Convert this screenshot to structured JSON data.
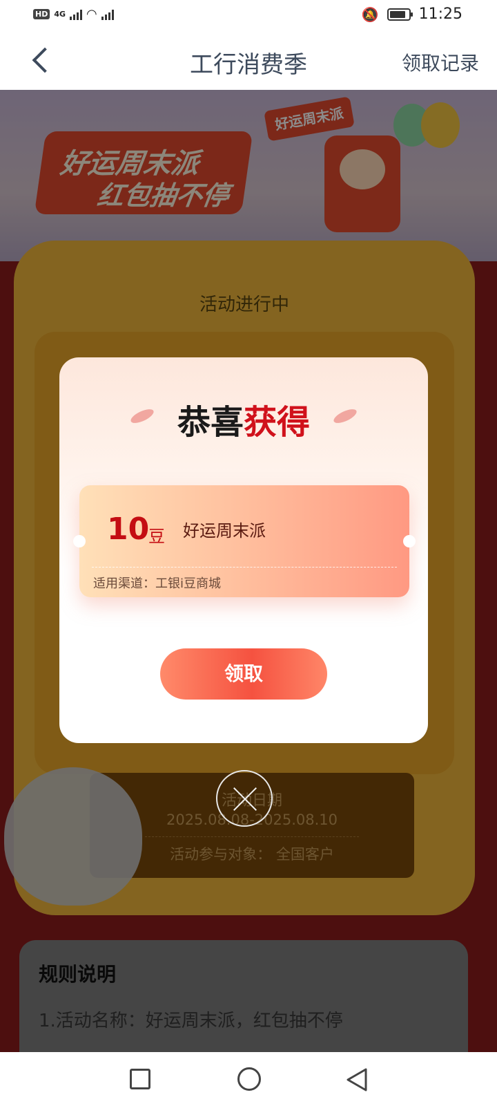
{
  "status_bar": {
    "hd": "HD",
    "network": "4G",
    "time": "11:25"
  },
  "nav": {
    "title": "工行消费季",
    "right_link": "领取记录"
  },
  "background": {
    "banner_line1": "好运周末派",
    "banner_line2": "红包抽不停",
    "banner_flag": "好运周末派",
    "machine_status": "活动进行中",
    "info_title": "活动日期",
    "info_dates": "2025.08.08-2025.08.10",
    "info_target": "活动参与对象：  全国客户",
    "rules_title": "规则说明",
    "rules_line1": "1.活动名称：好运周末派，红包抽不停"
  },
  "modal": {
    "title_part1": "恭喜",
    "title_part2": "获得",
    "coupon": {
      "amount": "10",
      "unit": "豆",
      "name": "好运周末派",
      "channel": "适用渠道：工银i豆商城"
    },
    "claim_button": "领取"
  },
  "colors": {
    "accent_red": "#d0111b",
    "button_gradient_start": "#ff8a6a",
    "button_gradient_mid": "#f55240"
  }
}
